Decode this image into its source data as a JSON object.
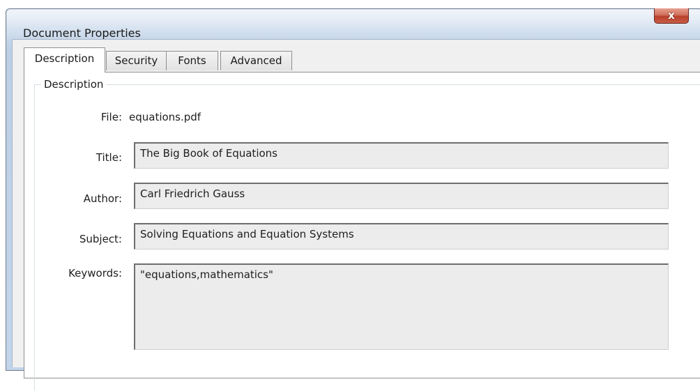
{
  "window": {
    "title": "Document Properties",
    "close_glyph": "x"
  },
  "tabs": [
    {
      "label": "Description",
      "active": true
    },
    {
      "label": "Security",
      "active": false
    },
    {
      "label": "Fonts",
      "active": false
    },
    {
      "label": "Advanced",
      "active": false
    }
  ],
  "description": {
    "group_label": "Description",
    "file_label": "File:",
    "file_value": "equations.pdf",
    "title_label": "Title:",
    "title_value": "The Big Book of Equations",
    "author_label": "Author:",
    "author_value": "Carl Friedrich Gauss",
    "subject_label": "Subject:",
    "subject_value": "Solving Equations and Equation Systems",
    "keywords_label": "Keywords:",
    "keywords_value": "\"equations,mathematics\""
  },
  "colors": {
    "frame": "#c3d5ea",
    "close_button": "#c95d45",
    "field_bg": "#ececec"
  }
}
